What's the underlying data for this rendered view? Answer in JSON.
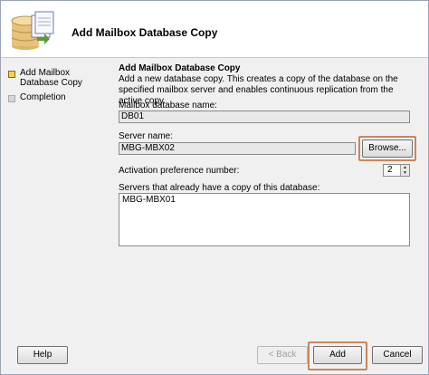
{
  "header": {
    "title": "Add Mailbox Database Copy",
    "icon": "database-copy-icon"
  },
  "sidebar": {
    "steps": [
      {
        "label": "Add Mailbox Database Copy",
        "state": "active"
      },
      {
        "label": "Completion",
        "state": "pending"
      }
    ]
  },
  "content": {
    "section_title": "Add Mailbox Database Copy",
    "description": "Add a new database copy. This creates a copy of the database on the specified mailbox server and enables continuous replication from the active copy.",
    "database_label": "Mailbox database name:",
    "database_value": "DB01",
    "server_label": "Server name:",
    "server_value": "MBG-MBX02",
    "browse_label": "Browse...",
    "activation_label": "Activation preference number:",
    "activation_value": "2",
    "existing_label": "Servers that already have a copy of this database:",
    "existing_servers": [
      "MBG-MBX01"
    ]
  },
  "footer": {
    "help_label": "Help",
    "back_label": "< Back",
    "add_label": "Add",
    "cancel_label": "Cancel"
  },
  "colors": {
    "highlight": "#c8875a",
    "active_step": "#f3d155"
  }
}
